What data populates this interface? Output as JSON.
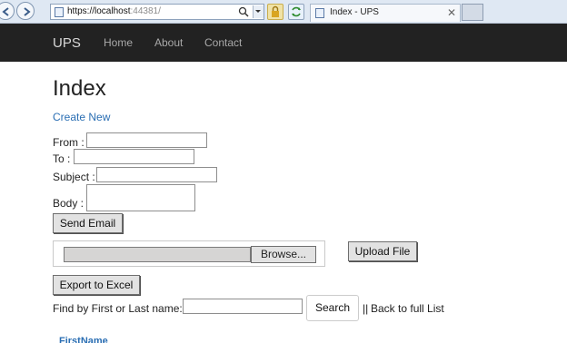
{
  "browser": {
    "url_main": "https://localhost",
    "url_port": ":44381/",
    "tab_title": "Index - UPS",
    "tab_close": "✕"
  },
  "navbar": {
    "brand": "UPS",
    "links": [
      "Home",
      "About",
      "Contact"
    ]
  },
  "page": {
    "title": "Index",
    "create_new": "Create New"
  },
  "email_form": {
    "from_label": "From :",
    "to_label": "To :",
    "subject_label": "Subject :",
    "body_label": "Body :",
    "from_value": "",
    "to_value": "",
    "subject_value": "",
    "body_value": "",
    "send_label": "Send Email"
  },
  "upload": {
    "browse_label": "Browse...",
    "upload_label": "Upload File"
  },
  "export": {
    "label": "Export to Excel"
  },
  "search": {
    "label": "Find by First or Last name:",
    "value": "",
    "button": "Search",
    "separator": "||",
    "back_link": "Back to full List"
  },
  "table": {
    "headers": [
      "FirstName"
    ]
  },
  "colors": {
    "navbar_bg": "#222222",
    "link": "#2a6eb3"
  }
}
